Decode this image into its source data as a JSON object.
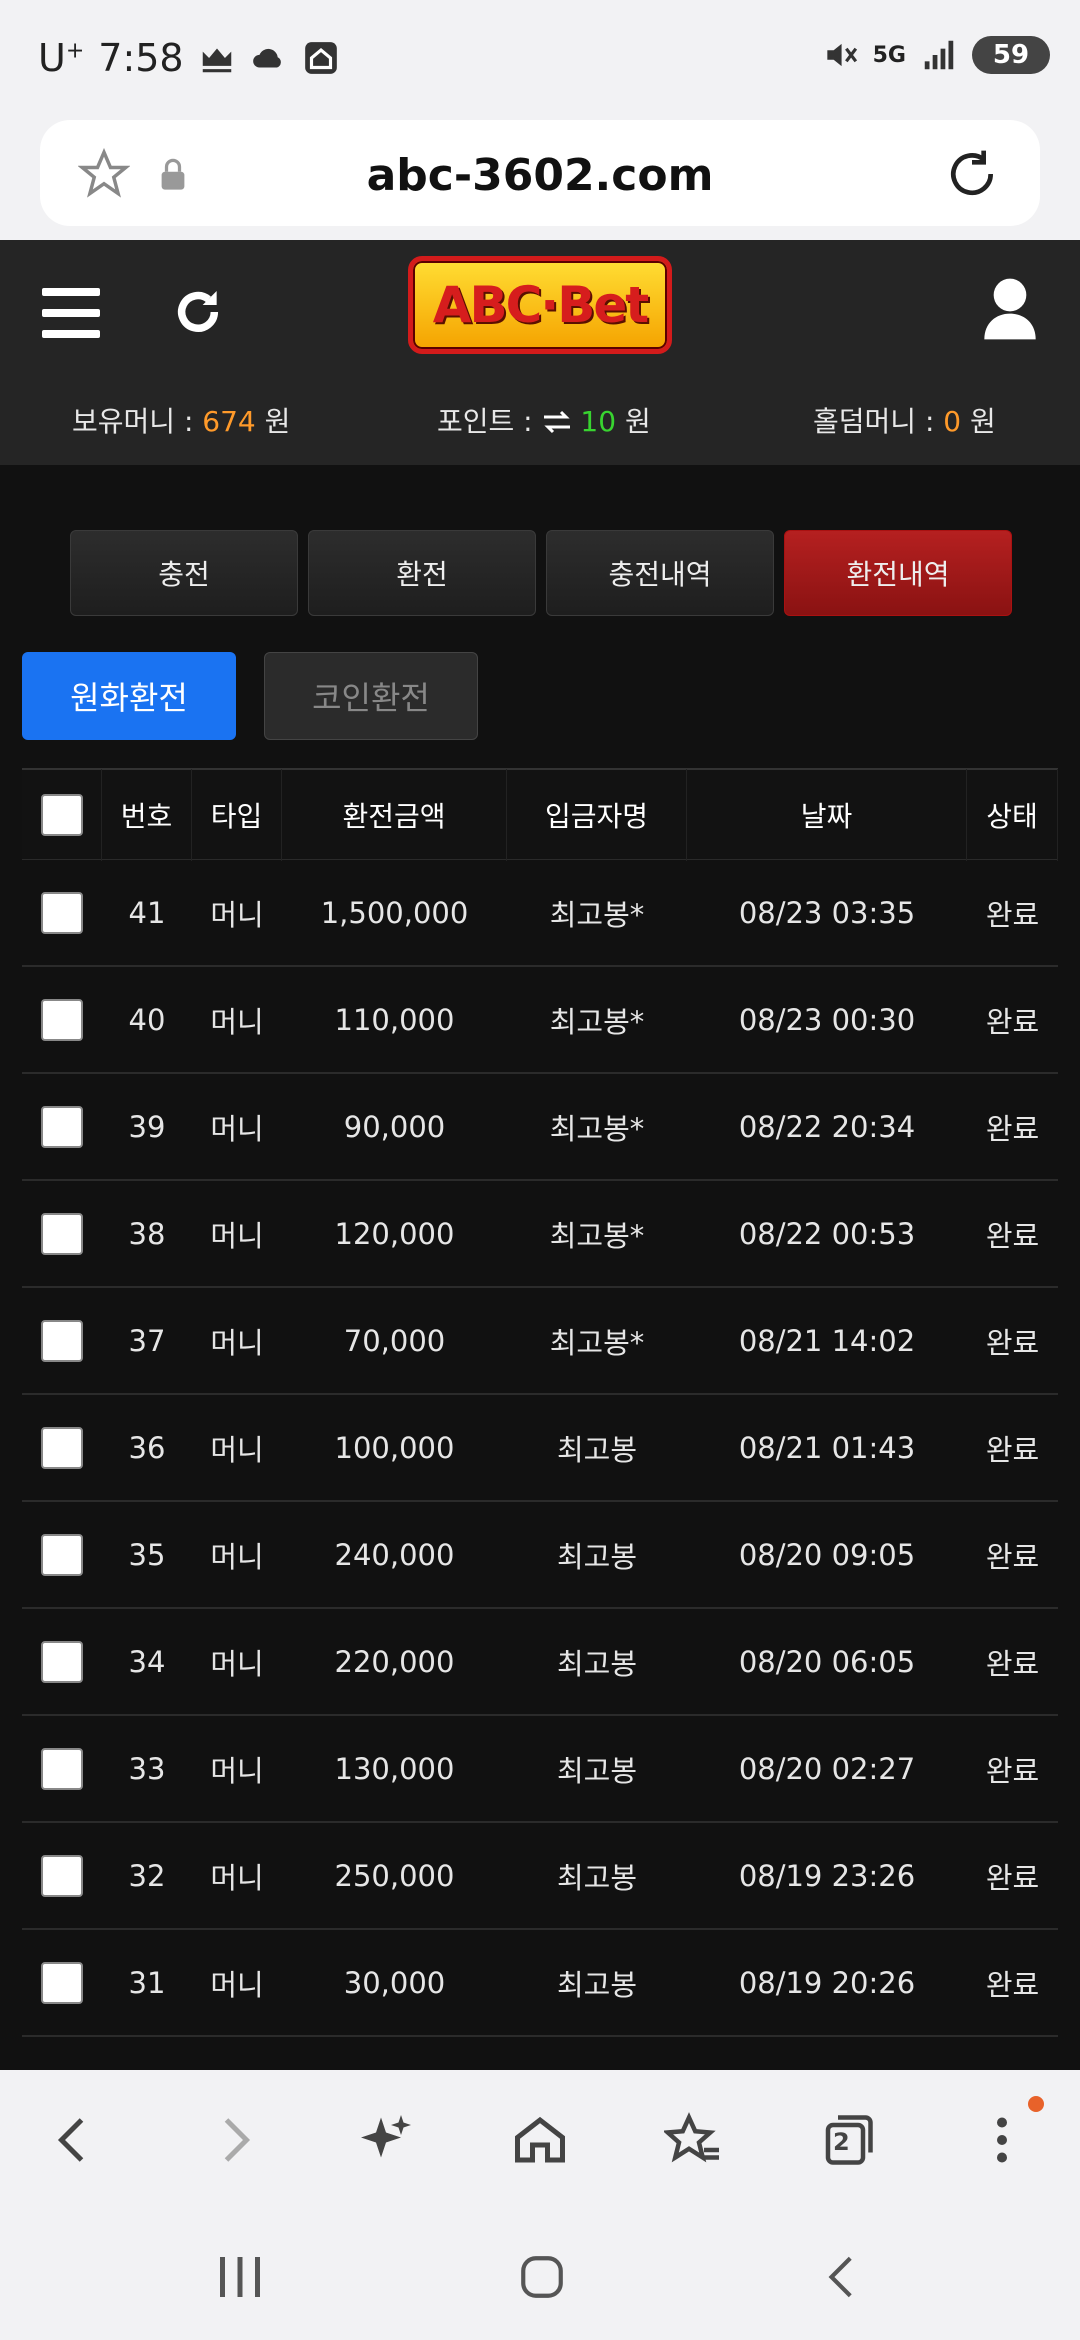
{
  "status": {
    "carrier": "U",
    "carrier_sup": "+",
    "time": "7:58",
    "network": "5G",
    "battery": "59"
  },
  "browser": {
    "url": "abc-3602.com"
  },
  "site": {
    "logo_text": "ABC·Bet",
    "balances": {
      "holding_label": "보유머니 : ",
      "holding_value": "674",
      "holding_unit": " 원",
      "point_label": "포인트 : ",
      "point_value": "10",
      "point_unit": " 원",
      "hold_label": "홀덤머니 : ",
      "hold_value": "0",
      "hold_unit": " 원"
    }
  },
  "tabs": [
    "충전",
    "환전",
    "충전내역",
    "환전내역"
  ],
  "subtabs": [
    "원화환전",
    "코인환전"
  ],
  "table": {
    "headers": [
      "번호",
      "타입",
      "환전금액",
      "입금자명",
      "날짜",
      "상태"
    ],
    "rows": [
      {
        "no": "41",
        "type": "머니",
        "amount": "1,500,000",
        "name": "최고봉*",
        "date": "08/23 03:35",
        "status": "완료"
      },
      {
        "no": "40",
        "type": "머니",
        "amount": "110,000",
        "name": "최고봉*",
        "date": "08/23 00:30",
        "status": "완료"
      },
      {
        "no": "39",
        "type": "머니",
        "amount": "90,000",
        "name": "최고봉*",
        "date": "08/22 20:34",
        "status": "완료"
      },
      {
        "no": "38",
        "type": "머니",
        "amount": "120,000",
        "name": "최고봉*",
        "date": "08/22 00:53",
        "status": "완료"
      },
      {
        "no": "37",
        "type": "머니",
        "amount": "70,000",
        "name": "최고봉*",
        "date": "08/21 14:02",
        "status": "완료"
      },
      {
        "no": "36",
        "type": "머니",
        "amount": "100,000",
        "name": "최고봉",
        "date": "08/21 01:43",
        "status": "완료"
      },
      {
        "no": "35",
        "type": "머니",
        "amount": "240,000",
        "name": "최고봉",
        "date": "08/20 09:05",
        "status": "완료"
      },
      {
        "no": "34",
        "type": "머니",
        "amount": "220,000",
        "name": "최고봉",
        "date": "08/20 06:05",
        "status": "완료"
      },
      {
        "no": "33",
        "type": "머니",
        "amount": "130,000",
        "name": "최고봉",
        "date": "08/20 02:27",
        "status": "완료"
      },
      {
        "no": "32",
        "type": "머니",
        "amount": "250,000",
        "name": "최고봉",
        "date": "08/19 23:26",
        "status": "완료"
      },
      {
        "no": "31",
        "type": "머니",
        "amount": "30,000",
        "name": "최고봉",
        "date": "08/19 20:26",
        "status": "완료"
      }
    ]
  },
  "toolbar": {
    "tabs_count": "2"
  }
}
